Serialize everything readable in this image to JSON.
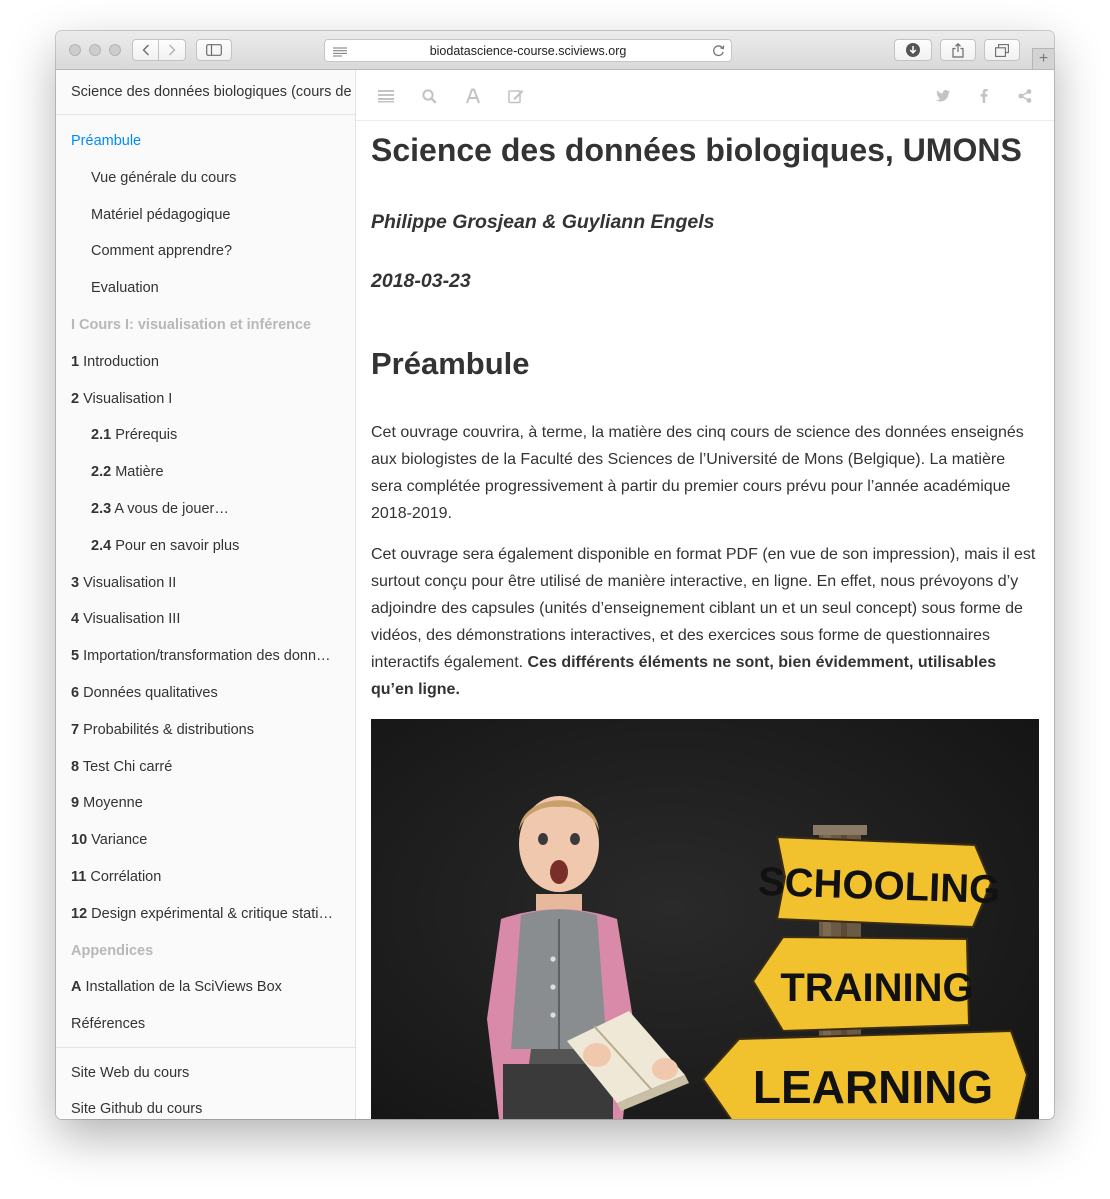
{
  "browser": {
    "url": "biodatascience-course.sciviews.org",
    "new_tab_label": "+"
  },
  "sidebar": {
    "book_title": "Science des données biologiques (cours de l'UMONS)",
    "items": [
      {
        "num": "",
        "label": "Préambule",
        "level": 1,
        "kind": "active"
      },
      {
        "num": "",
        "label": "Vue générale du cours",
        "level": 2,
        "kind": "normal"
      },
      {
        "num": "",
        "label": "Matériel pédagogique",
        "level": 2,
        "kind": "normal"
      },
      {
        "num": "",
        "label": "Comment apprendre?",
        "level": 2,
        "kind": "normal"
      },
      {
        "num": "",
        "label": "Evaluation",
        "level": 2,
        "kind": "normal"
      },
      {
        "num": "",
        "label": "I Cours I: visualisation et inférence",
        "level": 1,
        "kind": "part"
      },
      {
        "num": "1",
        "label": "Introduction",
        "level": 1,
        "kind": "normal"
      },
      {
        "num": "2",
        "label": "Visualisation I",
        "level": 1,
        "kind": "normal"
      },
      {
        "num": "2.1",
        "label": "Prérequis",
        "level": 2,
        "kind": "normal"
      },
      {
        "num": "2.2",
        "label": "Matière",
        "level": 2,
        "kind": "normal"
      },
      {
        "num": "2.3",
        "label": "A vous de jouer…",
        "level": 2,
        "kind": "normal"
      },
      {
        "num": "2.4",
        "label": "Pour en savoir plus",
        "level": 2,
        "kind": "normal"
      },
      {
        "num": "3",
        "label": "Visualisation II",
        "level": 1,
        "kind": "normal"
      },
      {
        "num": "4",
        "label": "Visualisation III",
        "level": 1,
        "kind": "normal"
      },
      {
        "num": "5",
        "label": "Importation/transformation des données",
        "level": 1,
        "kind": "normal"
      },
      {
        "num": "6",
        "label": "Données qualitatives",
        "level": 1,
        "kind": "normal"
      },
      {
        "num": "7",
        "label": "Probabilités & distributions",
        "level": 1,
        "kind": "normal"
      },
      {
        "num": "8",
        "label": "Test Chi carré",
        "level": 1,
        "kind": "normal"
      },
      {
        "num": "9",
        "label": "Moyenne",
        "level": 1,
        "kind": "normal"
      },
      {
        "num": "10",
        "label": "Variance",
        "level": 1,
        "kind": "normal"
      },
      {
        "num": "11",
        "label": "Corrélation",
        "level": 1,
        "kind": "normal"
      },
      {
        "num": "12",
        "label": "Design expérimental & critique statistique",
        "level": 1,
        "kind": "normal"
      },
      {
        "num": "",
        "label": "Appendices",
        "level": 1,
        "kind": "part"
      },
      {
        "num": "A",
        "label": "Installation de la SciViews Box",
        "level": 1,
        "kind": "normal"
      },
      {
        "num": "",
        "label": "Références",
        "level": 1,
        "kind": "normal"
      }
    ],
    "footer_links": [
      "Site Web du cours",
      "Site Github du cours"
    ]
  },
  "toolbar": {
    "icons": [
      "menu-icon",
      "search-icon",
      "font-icon",
      "edit-icon",
      "twitter-icon",
      "facebook-icon",
      "share-icon"
    ]
  },
  "content": {
    "title": "Science des données biologiques, UMONS",
    "authors": "Philippe Grosjean & Guyliann Engels",
    "date": "2018-03-23",
    "section_title": "Préambule",
    "para1": "Cet ouvrage couvrira, à terme, la matière des cinq cours de science des données enseignés aux biologistes de la Faculté des Sciences de l’Université de Mons (Belgique). La matière sera complétée progressivement à partir du premier cours prévu pour l’année académique 2018-2019.",
    "para2_text": "Cet ouvrage sera également disponible en format PDF (en vue de son impression), mais il est surtout conçu pour être utilisé de manière interactive, en ligne. En effet, nous prévoyons d’y adjoindre des capsules (unités d’enseignement ciblant un et un seul concept) sous forme de vidéos, des démonstrations interactives, et des exercices sous forme de questionnaires interactifs également. ",
    "para2_bold": "Ces différents éléments ne sont, bien évidemment, utilisables qu’en ligne.",
    "image": {
      "signs": [
        "SCHOOLING",
        "TRAINING",
        "LEARNING"
      ],
      "sign_color": "#f2c12e"
    }
  }
}
